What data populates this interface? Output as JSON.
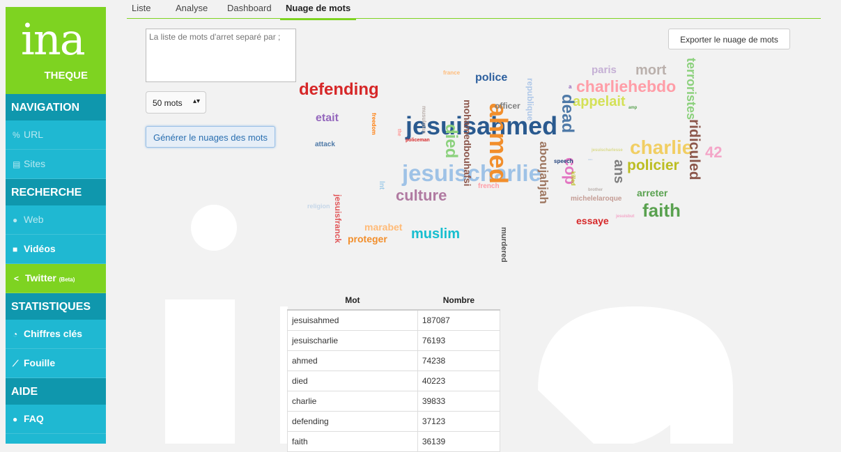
{
  "sidebar": {
    "logo_text": "ina",
    "logo_sub": "THEQUE",
    "sections": [
      {
        "title": "NAVIGATION",
        "items": [
          {
            "label": "URL"
          },
          {
            "label": "Sites"
          }
        ]
      },
      {
        "title": "RECHERCHE",
        "items": [
          {
            "label": "Web"
          },
          {
            "label": "Vidéos"
          },
          {
            "label": "Twitter",
            "badge": "(Beta)"
          }
        ]
      },
      {
        "title": "STATISTIQUES",
        "items": [
          {
            "label": "Chiffres clés"
          },
          {
            "label": "Fouille"
          }
        ]
      },
      {
        "title": "AIDE",
        "items": [
          {
            "label": "FAQ"
          }
        ]
      }
    ]
  },
  "tabs": [
    "Liste",
    "Analyse",
    "Dashboard",
    "Nuage de mots"
  ],
  "stopwords": {
    "placeholder": "La liste de mots d'arret separé par ;"
  },
  "word_count_select": {
    "value": "50 mots"
  },
  "generate_button": {
    "label": "Générer le nuages des mots"
  },
  "export_button": {
    "label": "Exporter le nuage de mots"
  },
  "cloud_words": [
    {
      "text": "jesuisahmed",
      "color": "#2a5a8f"
    },
    {
      "text": "jesuischarlie",
      "color": "#9ec2e6"
    },
    {
      "text": "ahmed",
      "color": "#f28e2b"
    },
    {
      "text": "died",
      "color": "#8cd17d"
    },
    {
      "text": "charlie",
      "color": "#f1ce63"
    },
    {
      "text": "defending",
      "color": "#d62728"
    },
    {
      "text": "faith",
      "color": "#59a14f"
    },
    {
      "text": "charliehebdo",
      "color": "#ff9da7"
    },
    {
      "text": "culture",
      "color": "#b07aa1"
    },
    {
      "text": "muslim",
      "color": "#17becf"
    },
    {
      "text": "policier",
      "color": "#bcbd22"
    },
    {
      "text": "mort",
      "color": "#bab0ac"
    },
    {
      "text": "appelait",
      "color": "#d4e157"
    },
    {
      "text": "ridiculed",
      "color": "#8c564b"
    },
    {
      "text": "aboujahjah",
      "color": "#9d7660"
    },
    {
      "text": "dead",
      "color": "#4e79a7"
    },
    {
      "text": "cop",
      "color": "#e377c2"
    },
    {
      "text": "ans",
      "color": "#7f7f7f"
    },
    {
      "text": "police",
      "color": "#2c5f9e"
    },
    {
      "text": "paris",
      "color": "#c5b0d5"
    },
    {
      "text": "terroristes",
      "color": "#8cd17d"
    },
    {
      "text": "42",
      "color": "#f4a6c8"
    },
    {
      "text": "mohamedbouhafsi",
      "color": "#8c564b"
    },
    {
      "text": "etait",
      "color": "#9467bd"
    },
    {
      "text": "arreter",
      "color": "#59a14f"
    },
    {
      "text": "essaye",
      "color": "#d62728"
    },
    {
      "text": "marabet",
      "color": "#ffbb78"
    },
    {
      "text": "proteger",
      "color": "#f28e2b"
    },
    {
      "text": "jesuisfranck",
      "color": "#e15759"
    },
    {
      "text": "murdered",
      "color": "#555555"
    },
    {
      "text": "republique",
      "color": "#aec7e8"
    },
    {
      "text": "officer",
      "color": "#7f7f7f"
    },
    {
      "text": "michelelaroque",
      "color": "#c49c94"
    },
    {
      "text": "french",
      "color": "#ff9da7"
    },
    {
      "text": "lnt",
      "color": "#a0cbe8"
    },
    {
      "text": "religion",
      "color": "#c5d6e8"
    },
    {
      "text": "attack",
      "color": "#4e79a7"
    },
    {
      "text": "france",
      "color": "#ffbb78"
    },
    {
      "text": "freedom",
      "color": "#ff7f0e"
    },
    {
      "text": "musulman",
      "color": "#bab0ac"
    },
    {
      "text": "policeman",
      "color": "#d62728"
    },
    {
      "text": "speech",
      "color": "#1f3f7a"
    },
    {
      "text": "killed",
      "color": "#bcbd22"
    },
    {
      "text": "jesuischarlesse",
      "color": "#dbdb8d"
    },
    {
      "text": "amp",
      "color": "#59a14f"
    },
    {
      "text": "a",
      "color": "#9467bd"
    },
    {
      "text": "brother",
      "color": "#bab0ac"
    },
    {
      "text": "jesuisbut",
      "color": "#f4a6c8"
    },
    {
      "text": "the",
      "color": "#ff9896"
    },
    {
      "text": "i",
      "color": "#c5d6e8"
    }
  ],
  "table": {
    "headers": [
      "Mot",
      "Nombre"
    ],
    "rows": [
      [
        "jesuisahmed",
        "187087"
      ],
      [
        "jesuischarlie",
        "76193"
      ],
      [
        "ahmed",
        "74238"
      ],
      [
        "died",
        "40223"
      ],
      [
        "charlie",
        "39833"
      ],
      [
        "defending",
        "37123"
      ],
      [
        "faith",
        "36139"
      ]
    ]
  }
}
